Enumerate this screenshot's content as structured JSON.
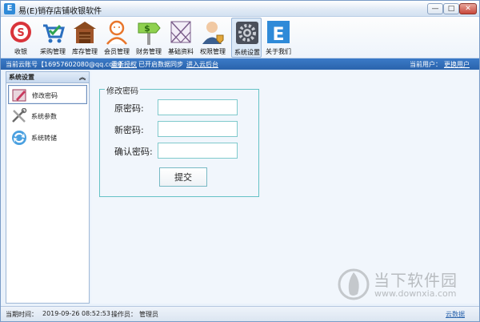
{
  "window": {
    "title": "易(E)销存店铺收银软件",
    "app_icon": "E",
    "minimize": "—",
    "maximize": "□",
    "close": "✕"
  },
  "toolbar": [
    {
      "label": "收银",
      "icon": "cashier-icon"
    },
    {
      "label": "采购管理",
      "icon": "cart-icon"
    },
    {
      "label": "库存管理",
      "icon": "warehouse-icon"
    },
    {
      "label": "会员管理",
      "icon": "member-icon"
    },
    {
      "label": "财务管理",
      "icon": "finance-icon"
    },
    {
      "label": "基础资料",
      "icon": "basic-data-icon"
    },
    {
      "label": "权限管理",
      "icon": "permission-icon"
    },
    {
      "label": "系统设置",
      "icon": "gear-icon",
      "active": true
    },
    {
      "label": "关于我们",
      "icon": "about-icon"
    }
  ],
  "account_bar": {
    "account_text": "当前云账号【16957602080@qq.com】",
    "reauthorize": "重新授权",
    "sync_status": "已开启数据同步",
    "enter_cloud": "进入云后台",
    "current_user_label": "当前用户：",
    "current_user": "更换用户"
  },
  "sidebar": {
    "title": "系统设置",
    "items": [
      {
        "label": "修改密码",
        "icon": "password-edit-icon",
        "active": true
      },
      {
        "label": "系统参数",
        "icon": "tools-icon"
      },
      {
        "label": "系统转储",
        "icon": "transfer-icon"
      }
    ]
  },
  "form": {
    "legend": "修改密码",
    "old_password_label": "原密码:",
    "new_password_label": "新密码:",
    "confirm_password_label": "确认密码:",
    "old_password_value": "",
    "new_password_value": "",
    "confirm_password_value": "",
    "submit_label": "提交"
  },
  "watermark": {
    "name": "当下软件园",
    "url": "www.downxia.com"
  },
  "status_bar": {
    "time_label": "当期时间：",
    "time_value": "2019-09-26 08:52:53",
    "operator_label": "操作员：",
    "operator_value": "管理员",
    "cloud_data": "云数据"
  },
  "colors": {
    "accent": "#2a63ac",
    "input_border": "#7fc9cc",
    "cashier_red": "#d9343a",
    "about_blue": "#2f8ad8"
  }
}
